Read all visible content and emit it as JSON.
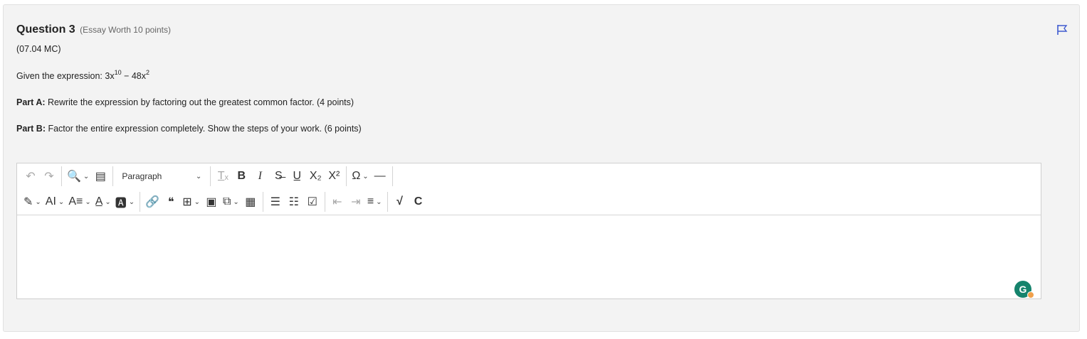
{
  "question": {
    "number_label": "Question 3",
    "meta": "(Essay Worth 10 points)",
    "code": "(07.04 MC)",
    "expression_prefix": "Given the expression: 3x",
    "exp1": "10",
    "expression_mid": " − 48x",
    "exp2": "2",
    "part_a_label": "Part A:",
    "part_a_text": " Rewrite the expression by factoring out the greatest common factor. (4 points)",
    "part_b_label": "Part B:",
    "part_b_text": " Factor the entire expression completely. Show the steps of your work. (6 points)"
  },
  "toolbar": {
    "row1": [
      {
        "name": "undo-button",
        "icon": "undo-icon",
        "glyph": "↶",
        "dim": true
      },
      {
        "name": "redo-button",
        "icon": "redo-icon",
        "glyph": "↷",
        "dim": true
      },
      {
        "sep": true
      },
      {
        "name": "find-replace-button",
        "icon": "search-replace-icon",
        "glyph": "🔍",
        "caret": true
      },
      {
        "name": "select-all-button",
        "icon": "select-all-icon",
        "glyph": "▤"
      },
      {
        "sep": true
      },
      {
        "name": "paragraph-dropdown",
        "type": "select",
        "value": "Paragraph"
      },
      {
        "sep": true
      },
      {
        "name": "remove-format-button",
        "icon": "remove-format-icon",
        "glyph": "T̲ₓ",
        "dim": true
      },
      {
        "name": "bold-button",
        "icon": "bold-icon",
        "glyph": "B",
        "bold": true
      },
      {
        "name": "italic-button",
        "icon": "italic-icon",
        "glyph": "I",
        "italic": true
      },
      {
        "name": "strikethrough-button",
        "icon": "strikethrough-icon",
        "glyph": "S̶"
      },
      {
        "name": "underline-button",
        "icon": "underline-icon",
        "glyph": "U̲"
      },
      {
        "name": "subscript-button",
        "icon": "subscript-icon",
        "glyph": "X₂"
      },
      {
        "name": "superscript-button",
        "icon": "superscript-icon",
        "glyph": "X²"
      },
      {
        "sep": true
      },
      {
        "name": "special-characters-button",
        "icon": "omega-icon",
        "glyph": "Ω",
        "caret": true
      },
      {
        "name": "horizontal-line-button",
        "icon": "horizontal-line-icon",
        "glyph": "—"
      },
      {
        "sep": true
      }
    ],
    "row2": [
      {
        "name": "highlight-button",
        "icon": "highlight-pen-icon",
        "glyph": "✎",
        "caret": true
      },
      {
        "name": "font-size-button",
        "icon": "font-size-icon",
        "glyph": "AI",
        "caret": true
      },
      {
        "name": "font-family-button",
        "icon": "font-family-icon",
        "glyph": "A≡",
        "caret": true
      },
      {
        "name": "font-color-button",
        "icon": "font-color-icon",
        "glyph": "A̲",
        "caret": true
      },
      {
        "name": "font-background-button",
        "icon": "font-background-icon",
        "glyph": "🅰",
        "caret": true
      },
      {
        "sep": true
      },
      {
        "name": "link-button",
        "icon": "link-icon",
        "glyph": "🔗"
      },
      {
        "name": "blockquote-button",
        "icon": "quote-icon",
        "glyph": "❝"
      },
      {
        "name": "table-button",
        "icon": "table-icon",
        "glyph": "⊞",
        "caret": true
      },
      {
        "name": "image-button",
        "icon": "image-icon",
        "glyph": "▣"
      },
      {
        "name": "media-embed-button",
        "icon": "media-embed-icon",
        "glyph": "⧉",
        "caret": true
      },
      {
        "name": "html-embed-button",
        "icon": "html-icon",
        "glyph": "▦"
      },
      {
        "sep": true
      },
      {
        "name": "bulleted-list-button",
        "icon": "bulleted-list-icon",
        "glyph": "☰"
      },
      {
        "name": "numbered-list-button",
        "icon": "numbered-list-icon",
        "glyph": "☷"
      },
      {
        "name": "todo-list-button",
        "icon": "todo-list-icon",
        "glyph": "☑"
      },
      {
        "sep": true
      },
      {
        "name": "outdent-button",
        "icon": "outdent-icon",
        "glyph": "⇤",
        "dim": true
      },
      {
        "name": "indent-button",
        "icon": "indent-icon",
        "glyph": "⇥",
        "dim": true
      },
      {
        "name": "alignment-button",
        "icon": "align-left-icon",
        "glyph": "≡",
        "caret": true
      },
      {
        "sep": true
      },
      {
        "name": "math-equation-button",
        "icon": "square-root-icon",
        "glyph": "√",
        "bold": true
      },
      {
        "name": "chemistry-button",
        "icon": "chemistry-icon",
        "glyph": "C",
        "bold": true
      }
    ]
  },
  "grammarly": {
    "letter": "G"
  }
}
